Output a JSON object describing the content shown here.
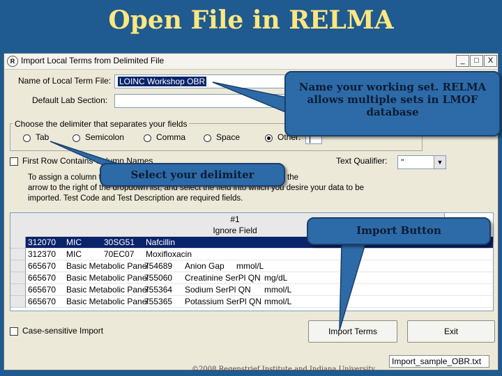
{
  "slide": {
    "title": "Open File in RELMA",
    "copyright": "©2008 Regenstrief Institute and Indiana University"
  },
  "window": {
    "icon_label": "R",
    "title": "Import Local Terms from Delimited File",
    "buttons": {
      "minimize": "_",
      "maximize": "□",
      "close": "X"
    }
  },
  "form": {
    "local_term_file_label": "Name of Local Term File:",
    "local_term_file_value": "LOINC Workshop OBR",
    "default_lab_section_label": "Default Lab Section:",
    "default_lab_section_value": "",
    "delimiter_group_label": "Choose the delimiter that separates your fields",
    "delimiters": [
      {
        "label": "Tab",
        "selected": false
      },
      {
        "label": "Semicolon",
        "selected": false
      },
      {
        "label": "Comma",
        "selected": false
      },
      {
        "label": "Space",
        "selected": false
      },
      {
        "label": "Other:",
        "selected": true
      }
    ],
    "other_value": "|",
    "first_row_label": "First Row Contains Column Names",
    "text_qualifier_label": "Text Qualifier:",
    "text_qualifier_value": "\"",
    "instructions": "To assign a column to a field, click on the header row of the grid, click on the arrow to the right of the dropdown list, and select the field into which you desire your data to be imported. Test Code and Test Description are required fields.",
    "instructions_line1": "To assign a column to a field, click on the header row of the grid, click on the",
    "instructions_line2": "arrow to the right of the dropdown list, and select the field into which you desire your data to be",
    "instructions_line3": "imported. Test Code and Test Description are required fields."
  },
  "grid": {
    "column_header": "#1",
    "column_field": "Ignore Field",
    "rows": [
      [
        "312070",
        "MIC",
        "30SG51",
        "Nafcillin",
        "",
        ""
      ],
      [
        "312370",
        "MIC",
        "70EC07",
        "Moxifloxacin",
        "",
        ""
      ],
      [
        "665670",
        "Basic Metabolic Panel",
        "754689",
        "Anion Gap",
        "mmol/L",
        ""
      ],
      [
        "665670",
        "Basic Metabolic Panel",
        "755060",
        "Creatinine SerPl QN",
        "mg/dL",
        ""
      ],
      [
        "665670",
        "Basic Metabolic Panel",
        "755364",
        "Sodium SerPl QN",
        "mmol/L",
        ""
      ],
      [
        "665670",
        "Basic Metabolic Panel",
        "755365",
        "Potassium SerPl QN",
        "mmol/L",
        ""
      ]
    ]
  },
  "footer": {
    "case_sensitive_label": "Case-sensitive Import",
    "import_button": "Import Terms",
    "exit_button": "Exit",
    "status_file": "Import_sample_OBR.txt"
  },
  "callouts": {
    "working_set": "Name your working set. RELMA allows multiple sets in LMOF database",
    "delimiter": "Select your delimiter",
    "import": "Import Button"
  },
  "colors": {
    "slide_bg": "#1f5a91",
    "title": "#ffe680",
    "callout_fill": "#2d6aa8",
    "selection": "#0a246a"
  }
}
